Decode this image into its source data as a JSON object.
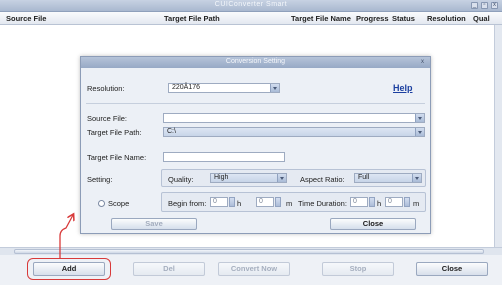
{
  "app": {
    "title": "CUIConverter Smart",
    "window_buttons": [
      "_",
      "▫",
      "x"
    ]
  },
  "columns": [
    "Source File",
    "Target File Path",
    "Target File Name",
    "Progress",
    "Status",
    "Resolution",
    "Qual"
  ],
  "toolbar": {
    "add": "Add",
    "del": "Del",
    "convert_now": "Convert Now",
    "stop": "Stop",
    "close": "Close"
  },
  "dialog": {
    "title": "Conversion Setting",
    "close_glyph": "x",
    "resolution_label": "Resolution:",
    "resolution_value": "220Â176",
    "help": "Help",
    "source_file_label": "Source File:",
    "source_file_value": "",
    "target_path_label": "Target File Path:",
    "target_path_value": "C:\\",
    "target_name_label": "Target File Name:",
    "target_name_value": "",
    "setting_label": "Setting:",
    "quality_label": "Quality:",
    "quality_value": "High",
    "aspect_label": "Aspect Ratio:",
    "aspect_value": "Full",
    "scope_label": "Scope",
    "begin_label": "Begin from:",
    "begin_h_value": "0",
    "h_unit": "h",
    "begin_m_value": "0",
    "m_unit": "m",
    "duration_label": "Time Duration:",
    "duration_h_value": "0",
    "duration_m_value": "0",
    "save": "Save",
    "close": "Close"
  },
  "colors": {
    "highlight": "#d83a3a",
    "help_link": "#1b3fa0"
  }
}
